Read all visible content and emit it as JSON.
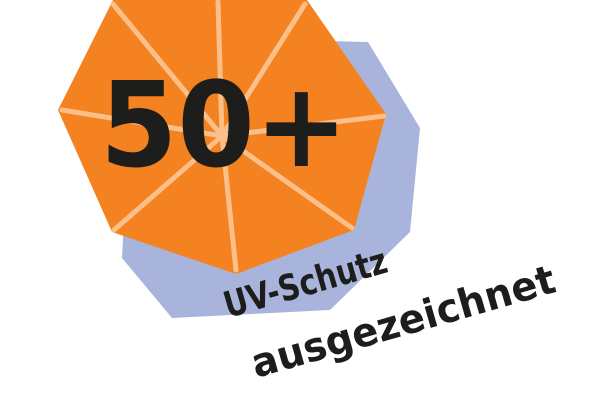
{
  "badge": {
    "headline": "50+",
    "line1": "UV-Schutz",
    "line2": "ausgezeichnet"
  },
  "colors": {
    "umbrella": "#f58220",
    "ribs": "#fbc08a",
    "shadow": "#a9b4dd",
    "text": "#1d1d1b",
    "background": "#ffffff"
  },
  "icons": {
    "umbrella": "umbrella-icon",
    "shadow": "shadow-shape"
  }
}
